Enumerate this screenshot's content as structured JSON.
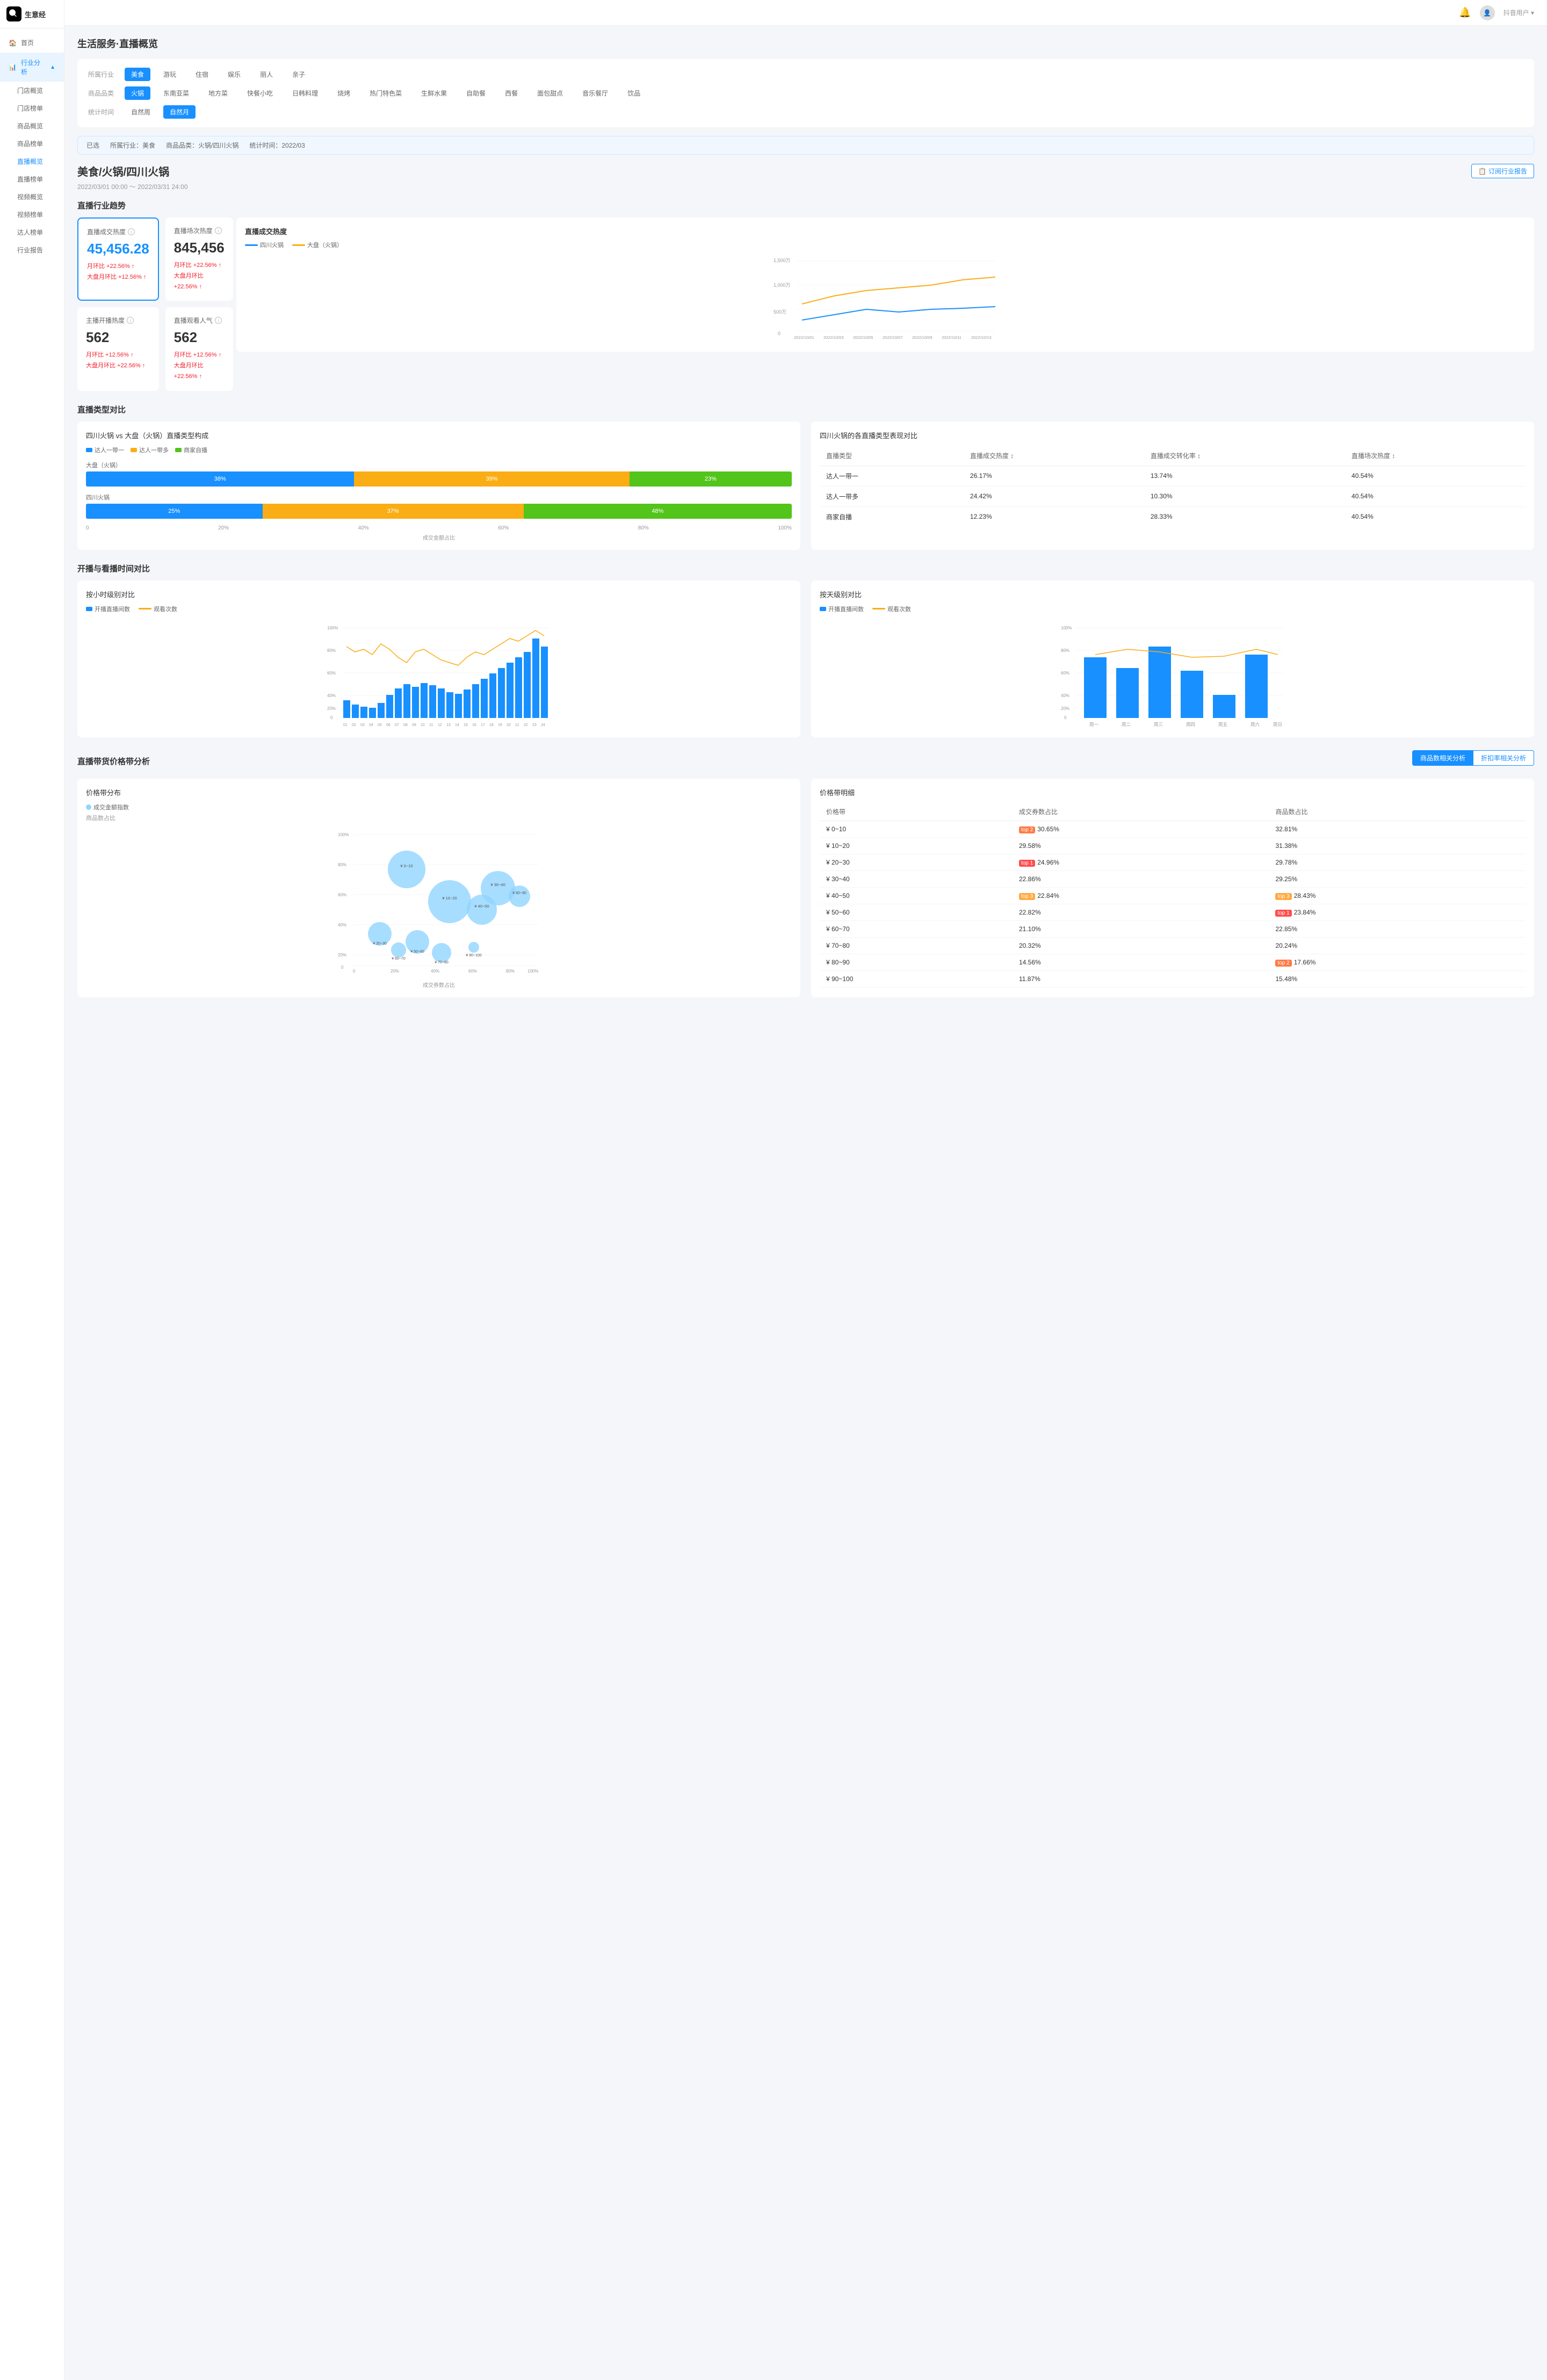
{
  "sidebar": {
    "logo_text": "生意经",
    "nav_items": [
      {
        "id": "home",
        "label": "首页",
        "icon": "home-icon",
        "active": false
      },
      {
        "id": "industry",
        "label": "行业分析",
        "icon": "chart-icon",
        "active": true,
        "expanded": true
      },
      {
        "id": "store-overview",
        "label": "门店概览",
        "sub": true,
        "active": false
      },
      {
        "id": "store-rank",
        "label": "门店榜单",
        "sub": true,
        "active": false
      },
      {
        "id": "product-overview",
        "label": "商品概览",
        "sub": true,
        "active": false
      },
      {
        "id": "product-rank",
        "label": "商品榜单",
        "sub": true,
        "active": false
      },
      {
        "id": "live-overview",
        "label": "直播概览",
        "sub": true,
        "active": true
      },
      {
        "id": "live-rank",
        "label": "直播榜单",
        "sub": true,
        "active": false
      },
      {
        "id": "video-overview",
        "label": "视频概览",
        "sub": true,
        "active": false
      },
      {
        "id": "video-rank",
        "label": "视频榜单",
        "sub": true,
        "active": false
      },
      {
        "id": "talent-rank",
        "label": "达人榜单",
        "sub": true,
        "active": false
      },
      {
        "id": "industry-report",
        "label": "行业报告",
        "sub": true,
        "active": false
      }
    ]
  },
  "topbar": {
    "bell_icon": "bell-icon",
    "avatar_text": "用户",
    "user_label": "抖音用户"
  },
  "page": {
    "header_title": "生活服务·直播概览",
    "breadcrumb": "美食/火锅/四川火锅",
    "report_btn": "订阅行业报告",
    "date_range": "2022/03/01 00:00 ～ 2022/03/31 24:00"
  },
  "filters": {
    "industry_label": "所属行业",
    "industry_items": [
      "美食",
      "游玩",
      "住宿",
      "娱乐",
      "丽人",
      "亲子"
    ],
    "industry_active": "美食",
    "product_label": "商品品类",
    "product_items": [
      "火锅",
      "东南亚菜",
      "地方菜",
      "快餐小吃",
      "日韩料理",
      "烧烤",
      "热门特色菜",
      "生鲜水果",
      "自助餐",
      "西餐",
      "面包甜点",
      "音乐餐厅",
      "饮品"
    ],
    "product_active": "火锅",
    "time_label": "统计时间",
    "time_items": [
      "自然周",
      "自然月"
    ],
    "time_active": "自然月"
  },
  "selected": {
    "label1": "所属行业：美食",
    "label2": "商品品类：火锅/四川火锅",
    "label3": "统计时间：2022/03"
  },
  "industry_trend": {
    "section_title": "直播行业趋势",
    "cards": [
      {
        "label": "直播成交热度",
        "value": "45,456.28",
        "meta1": "月环比 +22.56% ↑",
        "meta2": "大盘月环比 +12.56% ↑"
      },
      {
        "label": "直播场次热度",
        "value": "845,456",
        "meta1": "月环比 +22.56% ↑",
        "meta2": "大盘月环比 +22.56% ↑"
      },
      {
        "label": "主播开播热度",
        "value": "562",
        "meta1": "月环比 +12.56% ↑",
        "meta2": "大盘月环比 +22.56% ↑"
      },
      {
        "label": "直播观看人气",
        "value": "562",
        "meta1": "月环比 +12.56% ↑",
        "meta2": "大盘月环比 +22.56% ↑"
      }
    ],
    "chart_title": "直播成交热度",
    "chart_legend": [
      "四川火锅",
      "大盘（火锅）"
    ],
    "chart_ymax": "1,500万",
    "chart_ymid": "1,000万",
    "chart_ylow": "500万",
    "chart_dates": [
      "2022/10/01",
      "2022/10/03",
      "2022/10/05",
      "2022/10/07",
      "2022/10/09",
      "2022/10/11",
      "2022/10/13"
    ]
  },
  "live_type": {
    "section_title": "直播类型对比",
    "left_title": "四川火锅 vs 大盘（火锅）直播类型构成",
    "right_title": "四川火锅的各直播类型表现对比",
    "legends": [
      "达人一带一",
      "达人一带多",
      "商家自播"
    ],
    "bars": [
      {
        "label": "大盘（火锅）",
        "segs": [
          {
            "val": 38,
            "color": "#1890ff",
            "text": "38%"
          },
          {
            "val": 39,
            "color": "#faad14",
            "text": "39%"
          },
          {
            "val": 23,
            "color": "#52c41a",
            "text": "23%"
          }
        ]
      },
      {
        "label": "四川火锅",
        "segs": [
          {
            "val": 25,
            "color": "#1890ff",
            "text": "25%"
          },
          {
            "val": 37,
            "color": "#faad14",
            "text": "37%"
          },
          {
            "val": 48,
            "color": "#52c41a",
            "text": "48%"
          }
        ]
      }
    ],
    "axis_items": [
      "0",
      "20%",
      "40%",
      "60%",
      "80%",
      "100%"
    ],
    "axis_bottom": "成交金额占比",
    "table_headers": [
      "直播类型",
      "直播成交热度 ↕",
      "直播成交转化率 ↕",
      "直播场次热度 ↕"
    ],
    "table_rows": [
      [
        "达人一带一",
        "26.17%",
        "13.74%",
        "40.54%"
      ],
      [
        "达人一带多",
        "24.42%",
        "10.30%",
        "40.54%"
      ],
      [
        "商家自播",
        "12.23%",
        "28.33%",
        "40.54%"
      ]
    ]
  },
  "time_comparison": {
    "section_title": "开播与看播时间对比",
    "left_title": "按小时级别对比",
    "left_legend": [
      "开播直播间数",
      "观看次数"
    ],
    "left_x": [
      "01",
      "02",
      "03",
      "04",
      "05",
      "06",
      "07",
      "08",
      "09",
      "10",
      "11",
      "12",
      "13",
      "14",
      "15",
      "16",
      "17",
      "18",
      "19",
      "20",
      "21",
      "22",
      "23",
      "24"
    ],
    "right_title": "按天级别对比",
    "right_legend": [
      "开播直播间数",
      "观看次数"
    ],
    "right_x": [
      "周一",
      "周二",
      "周三",
      "周四",
      "周五",
      "周六",
      "周日"
    ]
  },
  "price_analysis": {
    "section_title": "直播带货价格带分析",
    "btn_active": "商品数相关分析",
    "btn_inactive": "折扣率相关分析",
    "left_title": "价格带分布",
    "left_legend": "成交金额指数",
    "left_ylabel": "商品数占比",
    "left_xlabel": "成交券数占比",
    "right_title": "价格带明细",
    "table_headers": [
      "价格带",
      "成交券数占比",
      "商品数占比"
    ],
    "table_rows": [
      {
        "range": "¥ 0~10",
        "tag1": "top 2",
        "val1": "30.65%",
        "val2": "32.81%"
      },
      {
        "range": "¥ 10~20",
        "tag1": "",
        "val1": "29.58%",
        "val2": "31.38%"
      },
      {
        "range": "¥ 20~30",
        "tag1": "top 1",
        "val1": "24.96%",
        "val2": "29.78%"
      },
      {
        "range": "¥ 30~40",
        "tag1": "",
        "val1": "22.86%",
        "val2": "29.25%"
      },
      {
        "range": "¥ 40~50",
        "tag1": "top 3",
        "val1": "22.84%",
        "tag2": "top 3",
        "val2": "28.43%"
      },
      {
        "range": "¥ 50~60",
        "tag1": "",
        "val1": "22.82%",
        "tag2": "top 1",
        "val2": "23.84%"
      },
      {
        "range": "¥ 60~70",
        "tag1": "",
        "val1": "21.10%",
        "val2": "22.85%"
      },
      {
        "range": "¥ 70~80",
        "tag1": "",
        "val1": "20.32%",
        "val2": "20.24%"
      },
      {
        "range": "¥ 80~90",
        "tag1": "",
        "val1": "14.56%",
        "tag2": "top 2",
        "val2": "17.66%"
      },
      {
        "range": "¥ 90~100",
        "tag1": "",
        "val1": "11.87%",
        "val2": "15.48%"
      }
    ]
  }
}
